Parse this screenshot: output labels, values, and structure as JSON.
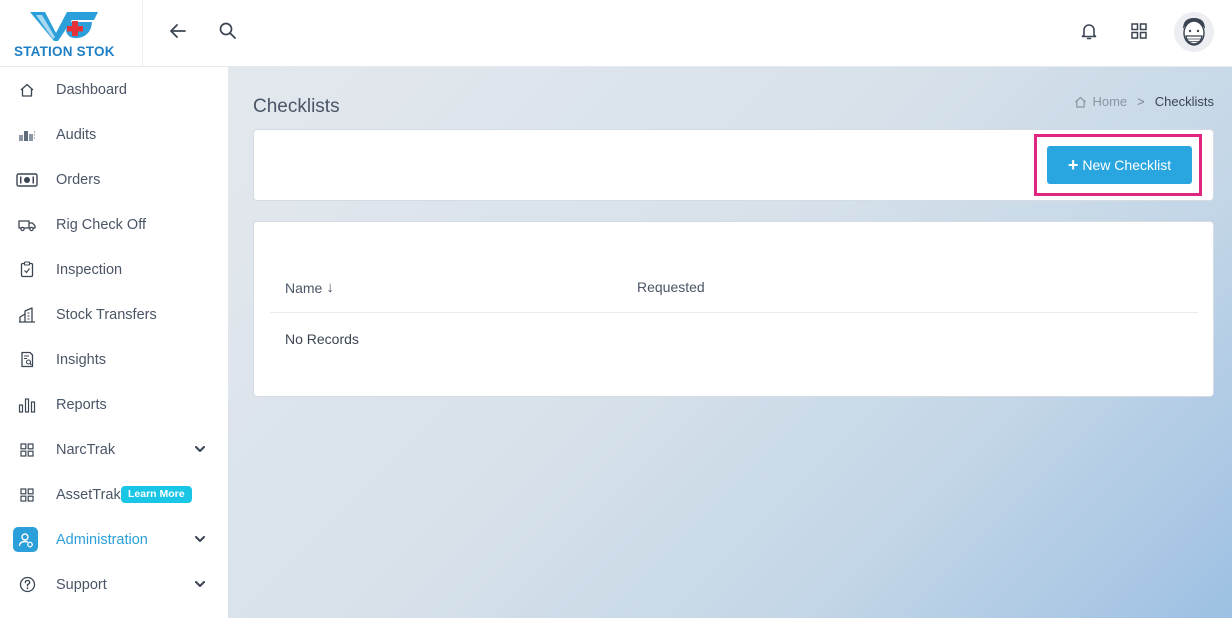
{
  "brand": {
    "name": "STATION STOK"
  },
  "header": {
    "icons": [
      "back-arrow-icon",
      "search-icon",
      "bell-icon",
      "apps-grid-icon",
      "user-avatar"
    ]
  },
  "sidebar": {
    "items": [
      {
        "label": "Dashboard",
        "icon": "home-icon"
      },
      {
        "label": "Audits",
        "icon": "audits-icon"
      },
      {
        "label": "Orders",
        "icon": "money-icon"
      },
      {
        "label": "Rig Check Off",
        "icon": "truck-icon"
      },
      {
        "label": "Inspection",
        "icon": "clipboard-icon"
      },
      {
        "label": "Stock Transfers",
        "icon": "building-icon"
      },
      {
        "label": "Insights",
        "icon": "report-search-icon"
      },
      {
        "label": "Reports",
        "icon": "bar-chart-icon"
      },
      {
        "label": "NarcTrak",
        "icon": "grid-icon"
      },
      {
        "label": "AssetTrak",
        "icon": "grid-icon",
        "badge": "Learn More"
      },
      {
        "label": "Administration",
        "icon": "admin-user-icon",
        "active": true
      },
      {
        "label": "Support",
        "icon": "help-circle-icon"
      }
    ]
  },
  "page": {
    "title": "Checklists",
    "breadcrumb": {
      "home": "Home",
      "separator": ">",
      "current": "Checklists"
    },
    "new_button": {
      "plus": "+",
      "label": "New Checklist"
    }
  },
  "table": {
    "columns": [
      {
        "label": "Name",
        "sort": "↓"
      },
      {
        "label": "Requested"
      }
    ],
    "empty_text": "No Records"
  },
  "colors": {
    "accent": "#29a6e0",
    "active_nav": "#2b9fd9",
    "highlight_border": "#e0267e",
    "badge": "#19c6e6"
  }
}
